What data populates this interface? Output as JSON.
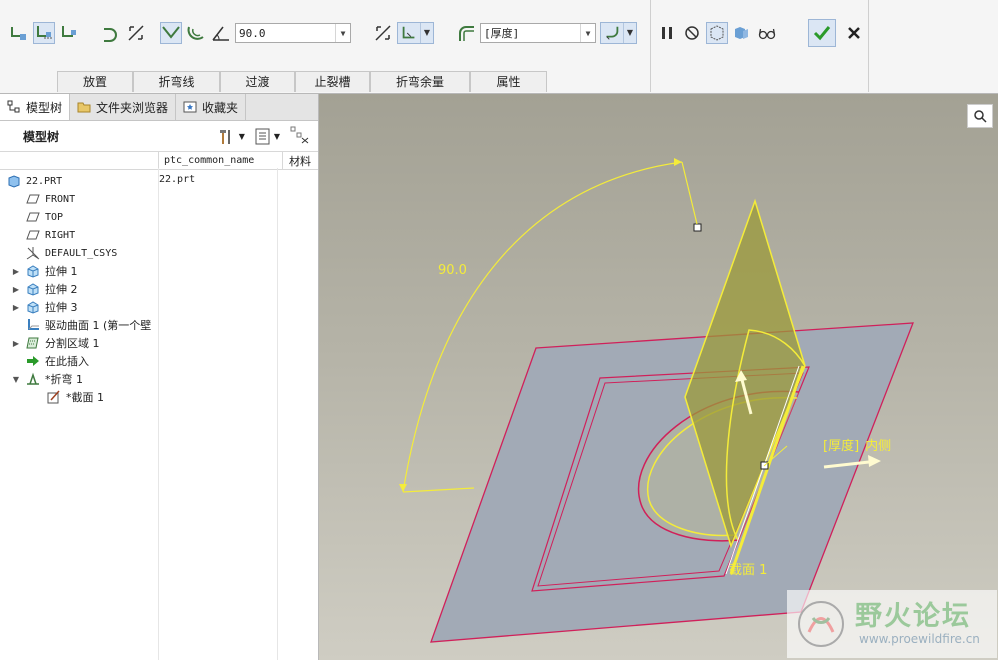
{
  "ribbon": {
    "angle_value": "90.0",
    "thickness_value": "[厚度]",
    "tabs": [
      "放置",
      "折弯线",
      "过渡",
      "止裂槽",
      "折弯余量",
      "属性"
    ]
  },
  "left_panel": {
    "tabs": [
      "模型树",
      "文件夹浏览器",
      "收藏夹"
    ],
    "title": "模型树",
    "columns": [
      "ptc_common_name",
      "材料"
    ],
    "rows": [
      {
        "label": "22.PRT",
        "name": "22.prt",
        "icon": "part-icon",
        "mono": true
      },
      {
        "label": "FRONT",
        "icon": "datum-plane-icon",
        "mono": true
      },
      {
        "label": "TOP",
        "icon": "datum-plane-icon",
        "mono": true
      },
      {
        "label": "RIGHT",
        "icon": "datum-plane-icon",
        "mono": true
      },
      {
        "label": "DEFAULT_CSYS",
        "icon": "csys-icon",
        "mono": true
      },
      {
        "label": "拉伸 1",
        "icon": "extrude-icon",
        "expander": true
      },
      {
        "label": "拉伸 2",
        "icon": "extrude-icon",
        "expander": true
      },
      {
        "label": "拉伸 3",
        "icon": "extrude-icon",
        "expander": true
      },
      {
        "label": "驱动曲面 1 (第一个壁",
        "icon": "surface-icon"
      },
      {
        "label": "分割区域 1",
        "icon": "split-area-icon",
        "expander": true
      },
      {
        "label": "在此插入",
        "icon": "insert-here-icon"
      },
      {
        "label": "*折弯 1",
        "icon": "bend-icon",
        "expanded": true
      },
      {
        "label": "*截面 1",
        "icon": "sketch-icon",
        "indent": true
      }
    ]
  },
  "viewport": {
    "angle_dim": "90.0",
    "thickness_note": "[厚度]",
    "side_note": "内侧",
    "section_note": "截面 1"
  },
  "watermark": {
    "cn": "野火论坛",
    "url": "www.proewildfire.cn"
  },
  "colors": {
    "viewport_top": "#a3a194",
    "plate": "#a2aab6",
    "edge": "#d0205a",
    "highlight": "#f4ec3a",
    "confirm": "#2a9a2a"
  }
}
